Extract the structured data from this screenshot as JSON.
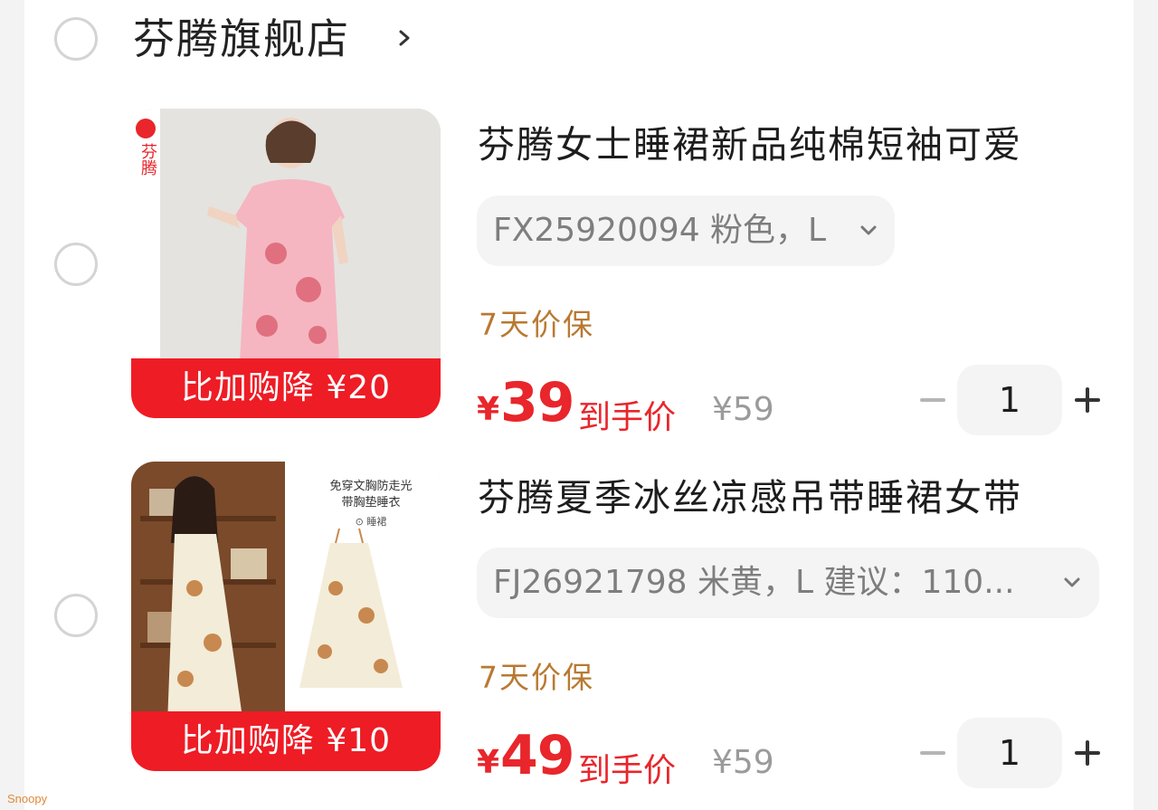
{
  "shop": {
    "name": "芬腾旗舰店"
  },
  "items": [
    {
      "title": "芬腾女士睡裙新品纯棉短袖可爱",
      "sku": "FX25920094 粉色，L",
      "guarantee": "7天价保",
      "currency": "¥",
      "price": "39",
      "price_label": "到手价",
      "original_price": "¥59",
      "promo": "比加购降 ¥20",
      "quantity": "1",
      "thumb_brand_text": "芬腾",
      "thumb_dress_color": "#f5b6c1"
    },
    {
      "title": "芬腾夏季冰丝凉感吊带睡裙女带",
      "sku": "FJ26921798 米黄，L 建议：110...",
      "guarantee": "7天价保",
      "currency": "¥",
      "price": "49",
      "price_label": "到手价",
      "original_price": "¥59",
      "promo": "比加购降 ¥10",
      "quantity": "1",
      "thumb_caption_line1": "免穿文胸防走光",
      "thumb_caption_line2": "带胸垫睡衣",
      "thumb_caption_tag": "⊙ 睡裙",
      "thumb_dress_color": "#f3ecd8"
    }
  ],
  "watermark": "Snoopy",
  "colors": {
    "accent_red": "#ee1c25",
    "price_red": "#e8262b",
    "guarantee_gold": "#b97932"
  }
}
